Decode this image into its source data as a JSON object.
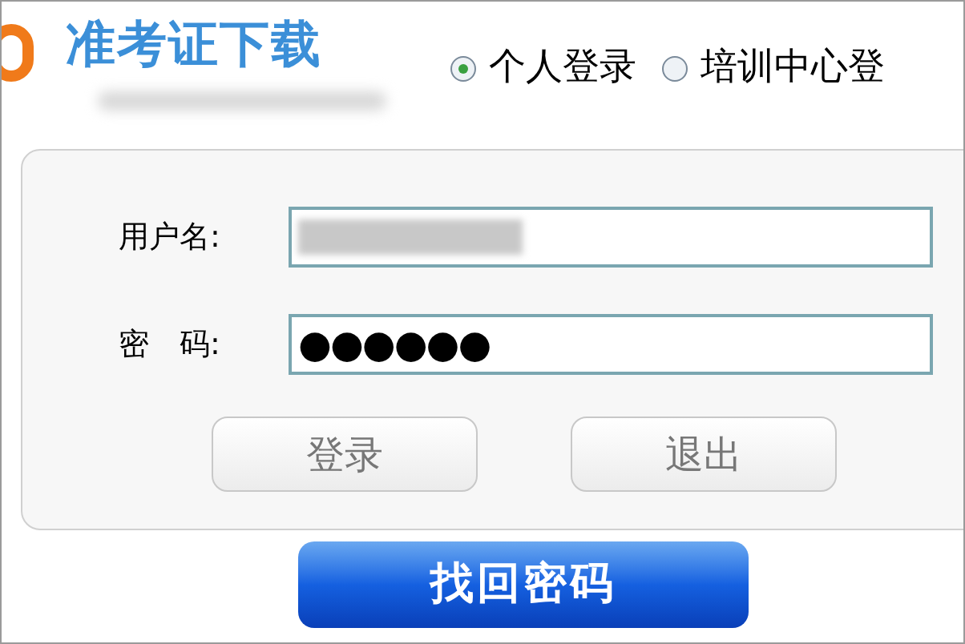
{
  "header": {
    "title": "准考证下载"
  },
  "login_type": [
    {
      "label": "个人登录",
      "selected": true
    },
    {
      "label": "培训中心登",
      "selected": false
    }
  ],
  "form": {
    "fields": [
      {
        "label": "用户名:",
        "kind": "blurred"
      },
      {
        "label": "密　码:",
        "kind": "password",
        "value": "●●●●●●"
      }
    ],
    "buttons": [
      "登录",
      "退出"
    ]
  },
  "recover_button": "找回密码"
}
